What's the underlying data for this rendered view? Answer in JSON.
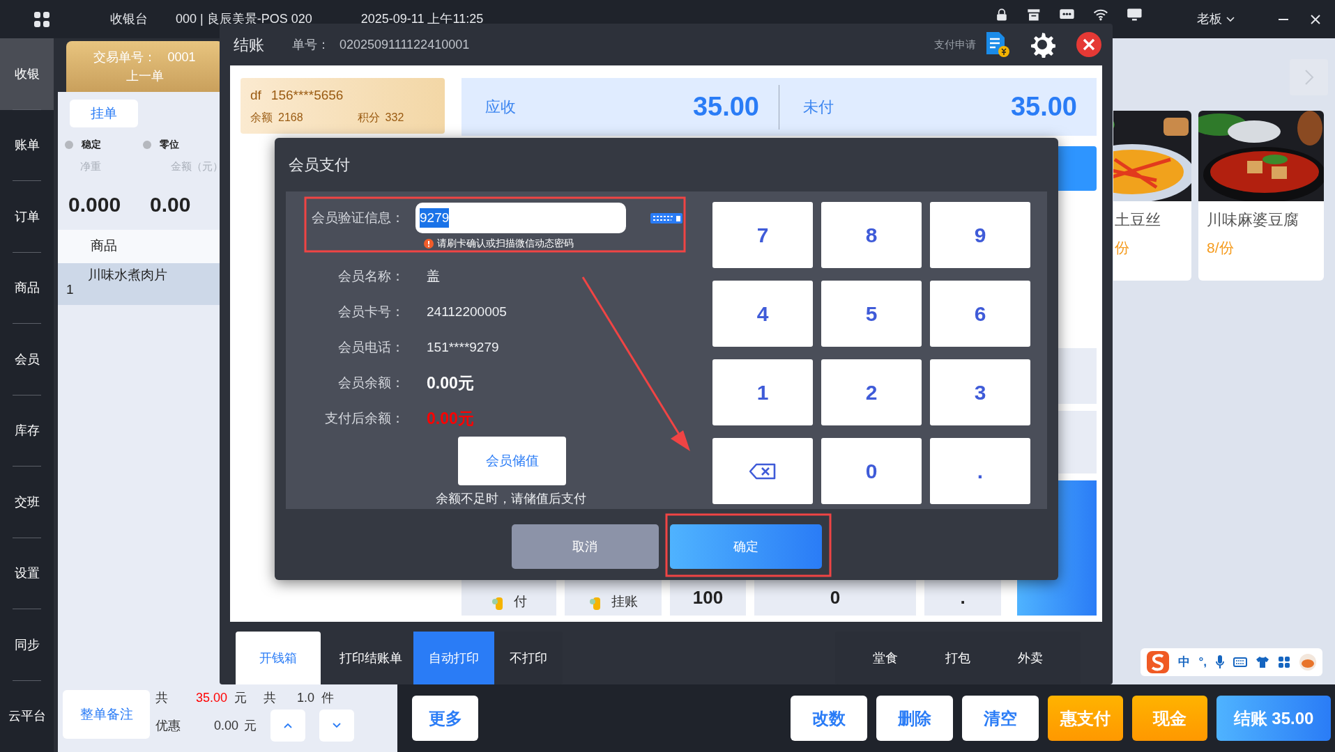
{
  "top_bar": {
    "app_title": "收银台",
    "store": "000 | 良辰美景-POS 020",
    "datetime": "2025-09-11 上午11:25",
    "user": "老板"
  },
  "sidebar": {
    "items": [
      {
        "label": "收银",
        "selected": true
      },
      {
        "label": "账单",
        "selected": false
      },
      {
        "label": "订单",
        "selected": false
      },
      {
        "label": "商品",
        "selected": false
      },
      {
        "label": "会员",
        "selected": false
      },
      {
        "label": "库存",
        "selected": false
      },
      {
        "label": "交班",
        "selected": false
      },
      {
        "label": "设置",
        "selected": false
      },
      {
        "label": "同步",
        "selected": false
      },
      {
        "label": "云平台",
        "selected": false
      }
    ]
  },
  "order_panel": {
    "order_no_label": "交易单号：",
    "order_no": "0001",
    "prev_button": "上一单",
    "hold_button": "挂单",
    "scale_flags": [
      {
        "label": "稳定",
        "on": false
      },
      {
        "label": "零位",
        "on": false
      }
    ],
    "weight_label": "净重",
    "amount_label": "金额（元）",
    "weight": "0.000",
    "amount": "0.00",
    "table": {
      "columns": [
        "商品"
      ],
      "rows": [
        {
          "index": "1",
          "name": "川味水煮肉片",
          "selected": true
        }
      ]
    },
    "remark_button": "整单备注",
    "totals": {
      "count_label": "共",
      "amount": "35.00",
      "unit": "元",
      "qty_label": "共",
      "qty": "1.0",
      "qty_unit": "件"
    },
    "discount_label": "优惠",
    "discount": "0.00",
    "discount_unit": "元"
  },
  "checkout": {
    "title": "结账",
    "order_no_label": "单号：",
    "order_no": "0202509111122410001",
    "pay_request": "支付申请",
    "member_card": {
      "name": "df",
      "phone": "156****5656",
      "balance_label": "余额",
      "balance": "2168",
      "points_label": "积分",
      "points": "332"
    },
    "summary": [
      {
        "label": "应收",
        "amount": "35.00"
      },
      {
        "label": "未付",
        "amount": "35.00"
      }
    ],
    "quick_pay": [
      {
        "kind": "method",
        "label": "付"
      },
      {
        "kind": "method",
        "label": "挂账"
      },
      {
        "kind": "amount",
        "label": "100"
      },
      {
        "kind": "amount",
        "label": "0"
      },
      {
        "kind": "amount",
        "label": "."
      }
    ],
    "cash_drawer_button": "开钱箱",
    "print_label": "打印结账单",
    "print_options": [
      {
        "label": "自动打印",
        "selected": true
      },
      {
        "label": "不打印",
        "selected": false
      }
    ],
    "dine_options": [
      {
        "label": "堂食",
        "selected": false
      },
      {
        "label": "打包",
        "selected": false
      },
      {
        "label": "外卖",
        "selected": false
      }
    ]
  },
  "member_dialog": {
    "title": "会员支付",
    "verify_label": "会员验证信息：",
    "verify_value": "9279",
    "hint": "请刷卡确认或扫描微信动态密码",
    "fields": [
      {
        "kind": "plain",
        "label": "会员名称：",
        "value": "盖"
      },
      {
        "kind": "plain",
        "label": "会员卡号：",
        "value": "24112200005"
      },
      {
        "kind": "plain",
        "label": "会员电话：",
        "value": "151****9279"
      },
      {
        "kind": "bold",
        "label": "会员余额：",
        "value": "0.00元"
      },
      {
        "kind": "alert",
        "label": "支付后余额：",
        "value": "0.00元"
      }
    ],
    "recharge_button": "会员储值",
    "note": "余额不足时，请储值后支付",
    "keypad": [
      {
        "kind": "key",
        "label": "7"
      },
      {
        "kind": "key",
        "label": "8"
      },
      {
        "kind": "key",
        "label": "9"
      },
      {
        "kind": "key",
        "label": "4"
      },
      {
        "kind": "key",
        "label": "5"
      },
      {
        "kind": "key",
        "label": "6"
      },
      {
        "kind": "key",
        "label": "1"
      },
      {
        "kind": "key",
        "label": "2"
      },
      {
        "kind": "key",
        "label": "3"
      },
      {
        "kind": "backspace"
      },
      {
        "kind": "key",
        "label": "0"
      },
      {
        "kind": "key",
        "label": "."
      }
    ],
    "cancel_button": "取消",
    "confirm_button": "确定"
  },
  "dishes": [
    {
      "name": "土豆丝",
      "price": "份"
    },
    {
      "name": "川味麻婆豆腐",
      "price": "8/份"
    }
  ],
  "ime_toolbar": {
    "items": [
      "中",
      "°,"
    ]
  },
  "bottom_bar": {
    "more_button": "更多",
    "actions": [
      {
        "kind": "plain",
        "label": "改数"
      },
      {
        "kind": "plain",
        "label": "删除"
      },
      {
        "kind": "plain",
        "label": "清空"
      },
      {
        "kind": "warm",
        "label": "惠支付"
      },
      {
        "kind": "warm",
        "label": "现金"
      },
      {
        "kind": "primary",
        "label": "结账 35.00"
      }
    ]
  }
}
